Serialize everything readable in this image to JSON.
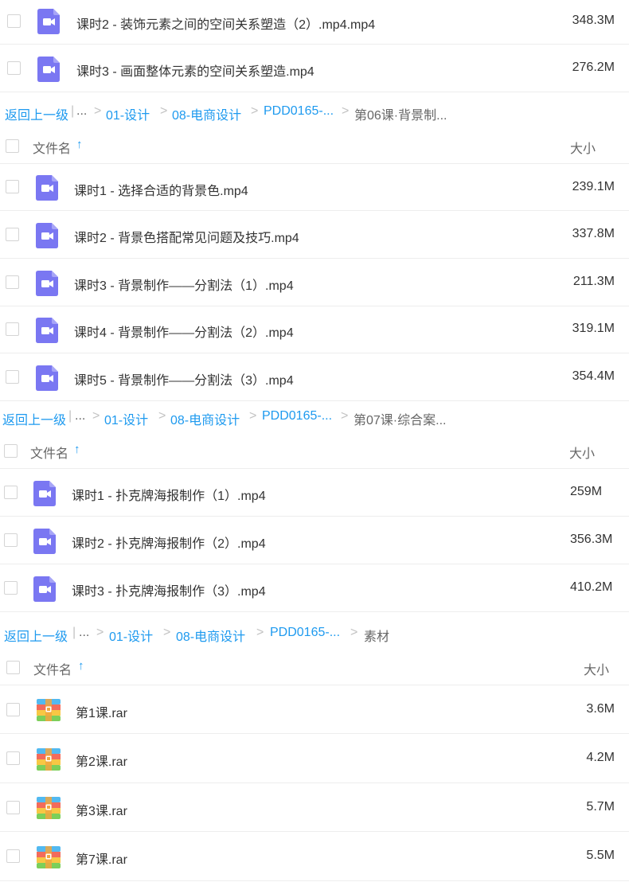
{
  "colors": {
    "link": "#1e9aef",
    "video_icon": "#7a77f2",
    "text": "#333333",
    "muted": "#666666"
  },
  "top_rows": [
    {
      "name": "课时2 - 装饰元素之间的空间关系塑造（2）.mp4.mp4",
      "size": "348.3M",
      "icon": "video-file-icon"
    },
    {
      "name": "课时3 - 画面整体元素的空间关系塑造.mp4",
      "size": "276.2M",
      "icon": "video-file-icon"
    }
  ],
  "sections": [
    {
      "breadcrumb": {
        "back": "返回上一级",
        "ellipsis": "...",
        "sep": ">",
        "items": [
          "01-设计",
          "08-电商设计",
          "PDD0165-..."
        ],
        "current": "第06课·背景制..."
      },
      "header": {
        "name_label": "文件名",
        "sort_arrow": "↑",
        "size_label": "大小"
      },
      "rows": [
        {
          "name": "课时1 - 选择合适的背景色.mp4",
          "size": "239.1M",
          "icon": "video-file-icon"
        },
        {
          "name": "课时2 - 背景色搭配常见问题及技巧.mp4",
          "size": "337.8M",
          "icon": "video-file-icon"
        },
        {
          "name": "课时3 - 背景制作——分割法（1）.mp4",
          "size": "211.3M",
          "icon": "video-file-icon"
        },
        {
          "name": "课时4 - 背景制作——分割法（2）.mp4",
          "size": "319.1M",
          "icon": "video-file-icon"
        },
        {
          "name": "课时5 - 背景制作——分割法（3）.mp4",
          "size": "354.4M",
          "icon": "video-file-icon"
        }
      ]
    },
    {
      "breadcrumb": {
        "back": "返回上一级",
        "ellipsis": "...",
        "sep": ">",
        "items": [
          "01-设计",
          "08-电商设计",
          "PDD0165-..."
        ],
        "current": "第07课·综合案..."
      },
      "header": {
        "name_label": "文件名",
        "sort_arrow": "↑",
        "size_label": "大小"
      },
      "rows": [
        {
          "name": "课时1 - 扑克牌海报制作（1）.mp4",
          "size": "259M",
          "icon": "video-file-icon"
        },
        {
          "name": "课时2 - 扑克牌海报制作（2）.mp4",
          "size": "356.3M",
          "icon": "video-file-icon"
        },
        {
          "name": "课时3 - 扑克牌海报制作（3）.mp4",
          "size": "410.2M",
          "icon": "video-file-icon"
        }
      ]
    },
    {
      "breadcrumb": {
        "back": "返回上一级",
        "ellipsis": "...",
        "sep": ">",
        "items": [
          "01-设计",
          "08-电商设计",
          "PDD0165-..."
        ],
        "current": "素材"
      },
      "header": {
        "name_label": "文件名",
        "sort_arrow": "↑",
        "size_label": "大小"
      },
      "rows": [
        {
          "name": "第1课.rar",
          "size": "3.6M",
          "icon": "archive-file-icon"
        },
        {
          "name": "第2课.rar",
          "size": "4.2M",
          "icon": "archive-file-icon"
        },
        {
          "name": "第3课.rar",
          "size": "5.7M",
          "icon": "archive-file-icon"
        },
        {
          "name": "第7课.rar",
          "size": "5.5M",
          "icon": "archive-file-icon"
        }
      ]
    }
  ]
}
